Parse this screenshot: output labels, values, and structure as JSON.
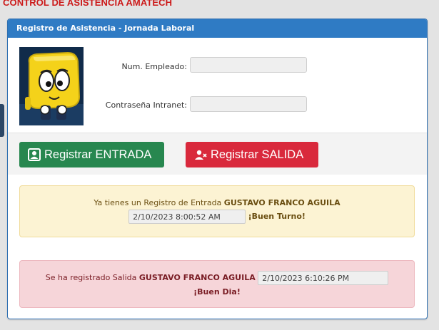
{
  "page_title": "CONTROL DE ASISTENCIA AMATECH",
  "panel": {
    "title": "Registro de Asistencia - Jornada Laboral"
  },
  "form": {
    "employee_label": "Num. Empleado:",
    "employee_value": "",
    "password_label": "Contraseña Intranet:",
    "password_value": ""
  },
  "buttons": {
    "entrada_label": "Registrar ENTRADA",
    "salida_label": "Registrar SALIDA"
  },
  "alert_entrada": {
    "prefix": "Ya tienes un Registro de Entrada",
    "name": "GUSTAVO FRANCO AGUILA",
    "timestamp": "2/10/2023 8:00:52 AM",
    "suffix": "¡Buen Turno!"
  },
  "alert_salida": {
    "prefix": "Se ha registrado Salida",
    "name": "GUSTAVO FRANCO AGUILA",
    "timestamp": "2/10/2023 6:10:26 PM",
    "suffix": "¡Buen Dia!"
  },
  "colors": {
    "title": "#cc1a1a",
    "header": "#2f7bc4",
    "entrada": "#27874f",
    "salida": "#d9293c",
    "warning_bg": "#fcf3d3",
    "danger_bg": "#f6d5d9"
  },
  "icons": {
    "avatar": "cartoon-mascot-avatar",
    "entrada": "user-square-icon",
    "salida": "user-x-icon"
  }
}
